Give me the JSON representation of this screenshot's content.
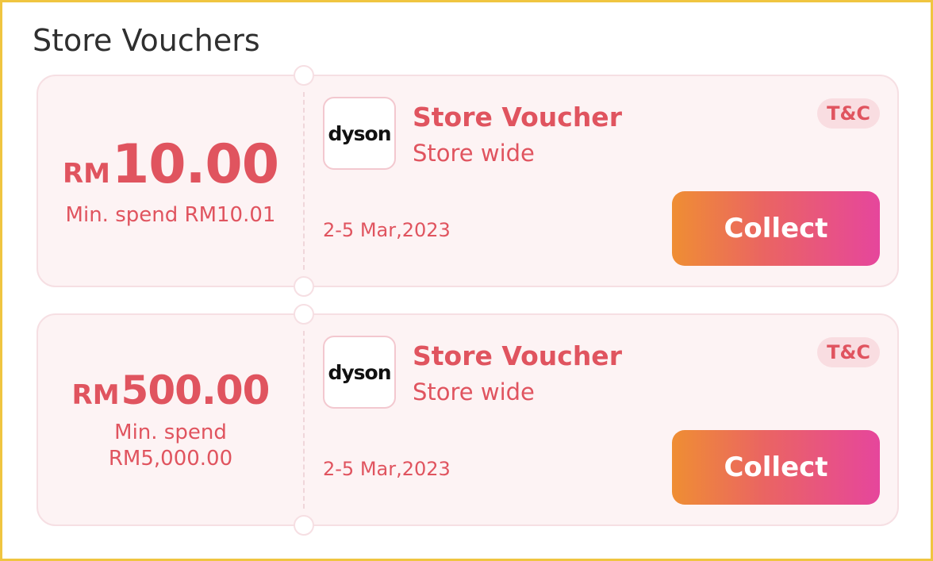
{
  "section": {
    "title": "Store Vouchers"
  },
  "vouchers": [
    {
      "currency": "RM",
      "amount": "10.00",
      "min_spend": "Min. spend RM10.01",
      "logo": "dyson",
      "title": "Store Voucher",
      "subtitle": "Store wide",
      "tc": "T&C",
      "date": "2-5 Mar,2023",
      "action": "Collect"
    },
    {
      "currency": "RM",
      "amount": "500.00",
      "min_spend": "Min. spend RM5,000.00",
      "logo": "dyson",
      "title": "Store Voucher",
      "subtitle": "Store wide",
      "tc": "T&C",
      "date": "2-5 Mar,2023",
      "action": "Collect"
    }
  ],
  "colors": {
    "accent": "#e0545f",
    "border": "#f0c540",
    "card_bg": "#fdf3f4",
    "button_gradient_start": "#ef8e33",
    "button_gradient_end": "#e6469c"
  }
}
